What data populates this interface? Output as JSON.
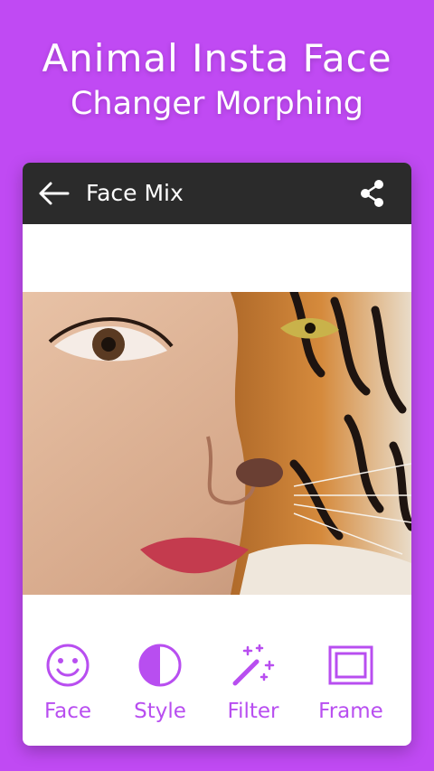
{
  "promo": {
    "line1": "Animal Insta Face",
    "line2": "Changer Morphing"
  },
  "appbar": {
    "title": "Face Mix",
    "back_icon": "arrow-left-icon",
    "share_icon": "share-icon"
  },
  "photo": {
    "description_icon": "face-mix-image"
  },
  "toolbar": {
    "items": [
      {
        "label": "Face",
        "icon": "smiley-icon"
      },
      {
        "label": "Style",
        "icon": "contrast-icon"
      },
      {
        "label": "Filter",
        "icon": "magic-wand-icon"
      },
      {
        "label": "Frame",
        "icon": "frame-icon"
      }
    ]
  },
  "colors": {
    "background": "#c04af3",
    "appbar": "#2b2b2b",
    "accent": "#b84ef0"
  }
}
